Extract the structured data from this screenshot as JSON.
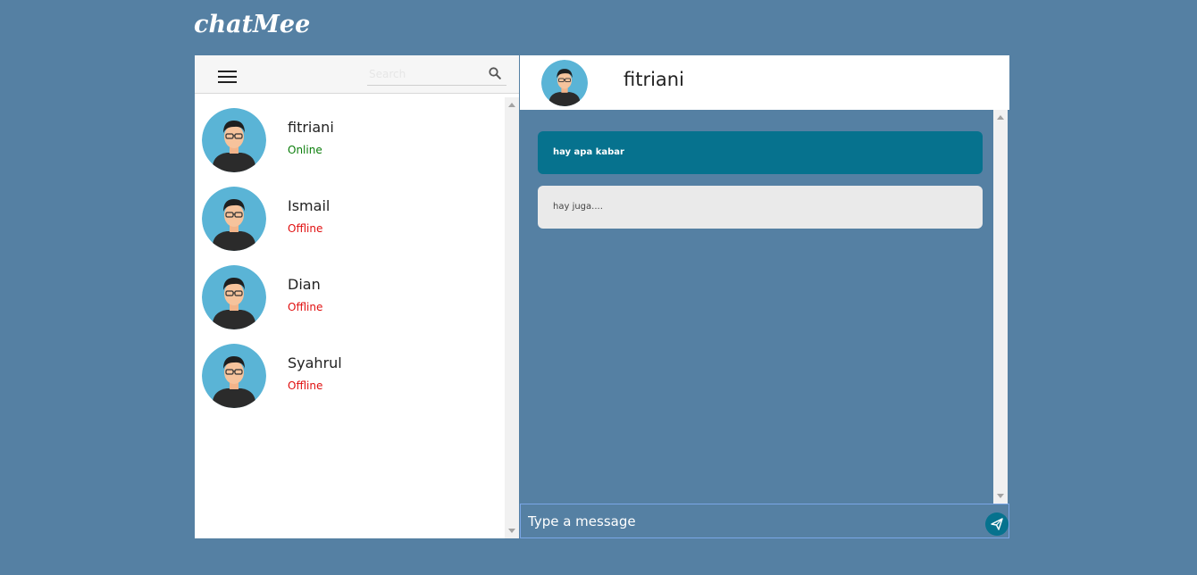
{
  "app": {
    "logo": "chatMee"
  },
  "sidebar": {
    "search_placeholder": "Search",
    "contacts": [
      {
        "name": "fitriani",
        "status": "Online"
      },
      {
        "name": "Ismail",
        "status": "Offline"
      },
      {
        "name": "Dian",
        "status": "Offline"
      },
      {
        "name": "Syahrul",
        "status": "Offline"
      }
    ]
  },
  "chat": {
    "contact_name": "fitriani",
    "messages": [
      {
        "direction": "outgoing",
        "text": "hay apa kabar"
      },
      {
        "direction": "incoming",
        "text": "hay juga...."
      }
    ],
    "composer_placeholder": "Type a message"
  },
  "colors": {
    "background": "#5580a3",
    "accent": "#06728e",
    "online": "#0a7d0a",
    "offline": "#e01010",
    "incoming_bubble": "#eaeaea"
  },
  "icons": {
    "menu": "hamburger-icon",
    "search": "search-icon",
    "send": "send-icon",
    "avatar": "user-avatar-icon"
  }
}
